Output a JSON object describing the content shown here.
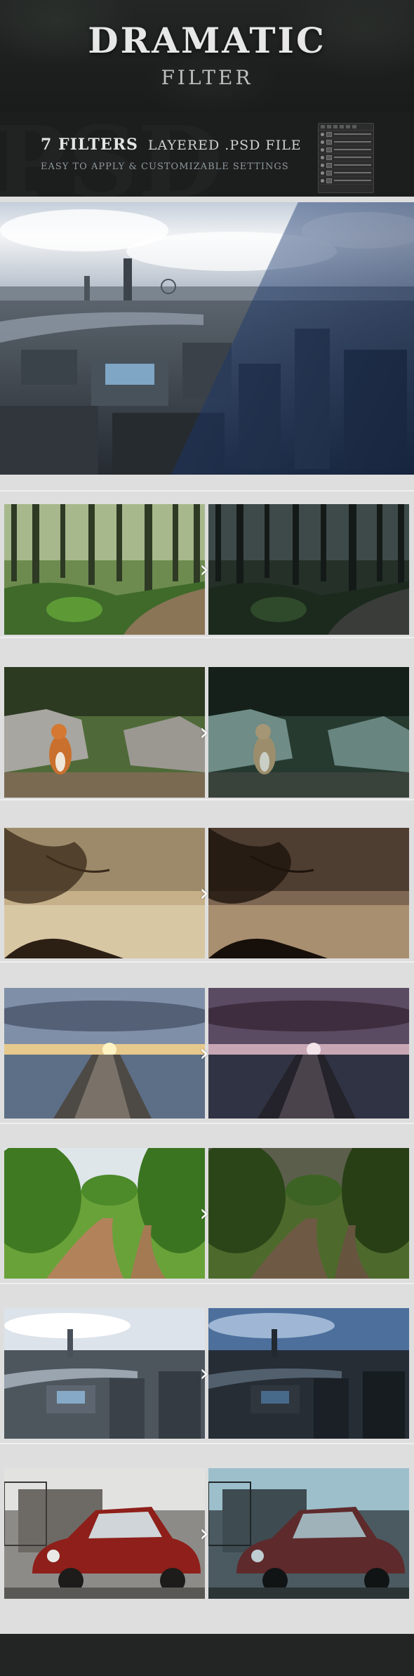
{
  "header": {
    "title": "DRAMATIC",
    "subtitle": "FILTER",
    "filter_count": "7 FILTERS",
    "file_type": "LAYERED .PSD FILE",
    "tagline": "EASY TO APPLY & CUSTOMIZABLE SETTINGS"
  },
  "hero": {
    "scene": "city-aerial",
    "split": "diagonal before / after"
  },
  "comparisons": [
    {
      "scene": "forest-path"
    },
    {
      "scene": "fox-on-rocks"
    },
    {
      "scene": "misty-lake-tree"
    },
    {
      "scene": "pier-sunset"
    },
    {
      "scene": "country-road"
    },
    {
      "scene": "city-aerial"
    },
    {
      "scene": "red-car-ruins"
    }
  ],
  "colors": {
    "header_bg": "#1d1f1f",
    "panel_bg": "#dedede",
    "arrow": "#ffffff",
    "title": "#e7e7e7"
  },
  "icons": {
    "arrow": "chevron-right-icon",
    "layers_panel": "layers-panel-icon"
  }
}
